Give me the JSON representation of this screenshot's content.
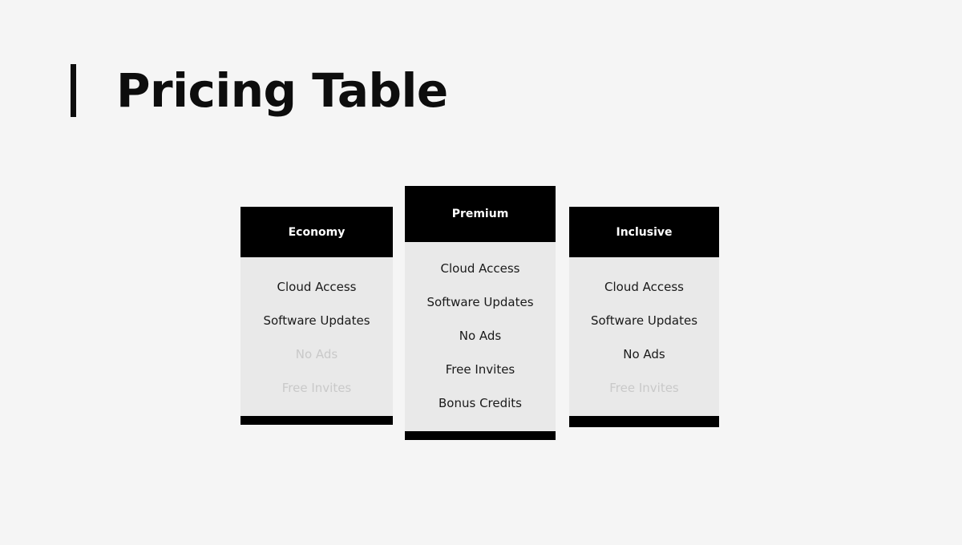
{
  "header": {
    "title": "Pricing Table",
    "accent_color": "#0d0d0d"
  },
  "theme": {
    "page_background": "#f5f5f5",
    "card_background": "#e9e9e9",
    "card_header_background": "#000000",
    "card_header_text": "#ffffff",
    "feature_enabled_color": "#1a1a1a",
    "feature_disabled_color": "#c9c9c9",
    "footer_color": "#000000"
  },
  "plans": [
    {
      "name": "Economy",
      "featured": false,
      "features": [
        {
          "label": "Cloud Access",
          "included": true
        },
        {
          "label": "Software Updates",
          "included": true
        },
        {
          "label": "No Ads",
          "included": false
        },
        {
          "label": "Free Invites",
          "included": false
        }
      ]
    },
    {
      "name": "Premium",
      "featured": true,
      "features": [
        {
          "label": "Cloud Access",
          "included": true
        },
        {
          "label": "Software Updates",
          "included": true
        },
        {
          "label": "No Ads",
          "included": true
        },
        {
          "label": "Free Invites",
          "included": true
        },
        {
          "label": "Bonus Credits",
          "included": true
        }
      ]
    },
    {
      "name": "Inclusive",
      "featured": false,
      "features": [
        {
          "label": "Cloud Access",
          "included": true
        },
        {
          "label": "Software Updates",
          "included": true
        },
        {
          "label": "No Ads",
          "included": true
        },
        {
          "label": "Free Invites",
          "included": false
        }
      ]
    }
  ]
}
